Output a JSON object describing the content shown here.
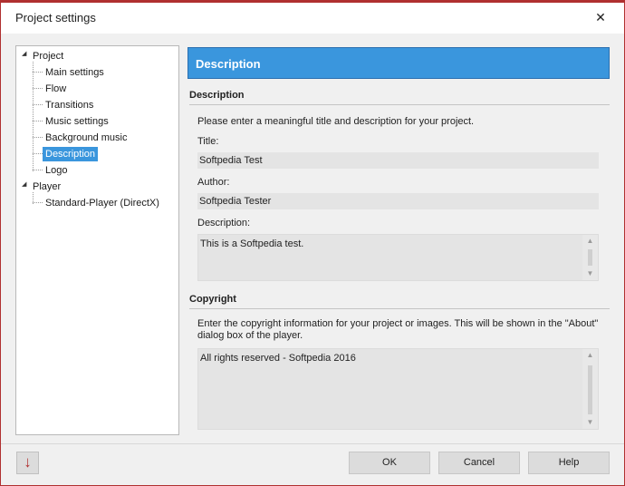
{
  "window": {
    "title": "Project settings",
    "close_glyph": "✕"
  },
  "tree": {
    "nodes": [
      {
        "label": "Project",
        "expander": "◢",
        "expanded": true
      },
      {
        "label": "Main settings"
      },
      {
        "label": "Flow"
      },
      {
        "label": "Transitions"
      },
      {
        "label": "Music settings"
      },
      {
        "label": "Background music"
      },
      {
        "label": "Description",
        "selected": true
      },
      {
        "label": "Logo"
      },
      {
        "label": "Player",
        "expander": "◢",
        "expanded": true
      },
      {
        "label": "Standard-Player (DirectX)"
      }
    ]
  },
  "header": {
    "title": "Description",
    "color": "#3a96dd"
  },
  "description_section": {
    "heading": "Description",
    "intro": "Please enter a meaningful title and description for your project.",
    "title_label": "Title:",
    "title_value": "Softpedia Test",
    "author_label": "Author:",
    "author_value": "Softpedia Tester",
    "description_label": "Description:",
    "description_value": "This is a Softpedia test."
  },
  "copyright_section": {
    "heading": "Copyright",
    "intro_line1": "Enter the copyright information for your project or images. This will be shown in the \"About\"",
    "intro_line2": "dialog box of the player.",
    "value": "All rights reserved - Softpedia 2016"
  },
  "buttons": {
    "arrow_icon": "down-arrow-icon",
    "arrow_glyph": "↓",
    "ok": "OK",
    "cancel": "Cancel",
    "help": "Help"
  },
  "scroll": {
    "up_glyph": "▲",
    "down_glyph": "▼"
  },
  "colors": {
    "accent": "#3a96dd",
    "window_border": "#b03030"
  }
}
